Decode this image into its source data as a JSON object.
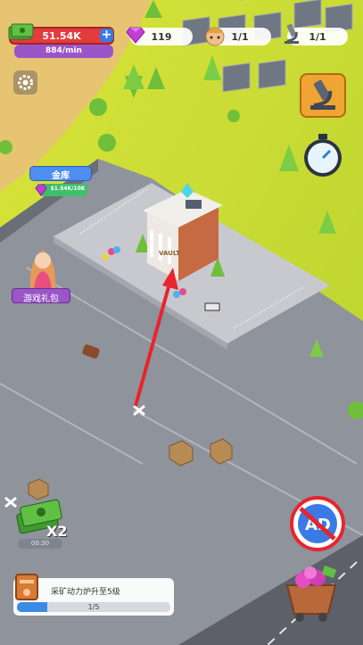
{
  "hud": {
    "money": "51.54K",
    "rate": "884/min",
    "gems": "119",
    "workers": "1/1",
    "researchers": "1/1"
  },
  "vault_sign": "VAULT",
  "bank_tag": {
    "title": "金库",
    "value": "$1.54K/10K"
  },
  "gift_label": "游戏礼包",
  "double_label": "X2",
  "double_timer": "00:30",
  "task": {
    "text": "采矿动力炉升至5级",
    "progress_text": "1/5",
    "progress": 0.2
  },
  "colors": {
    "money_red": "#e23c3c",
    "gem_purple": "#c13fd6",
    "accent_orange": "#f0a433",
    "progress_blue": "#3a8be6",
    "arrow_red": "#e8242c"
  }
}
